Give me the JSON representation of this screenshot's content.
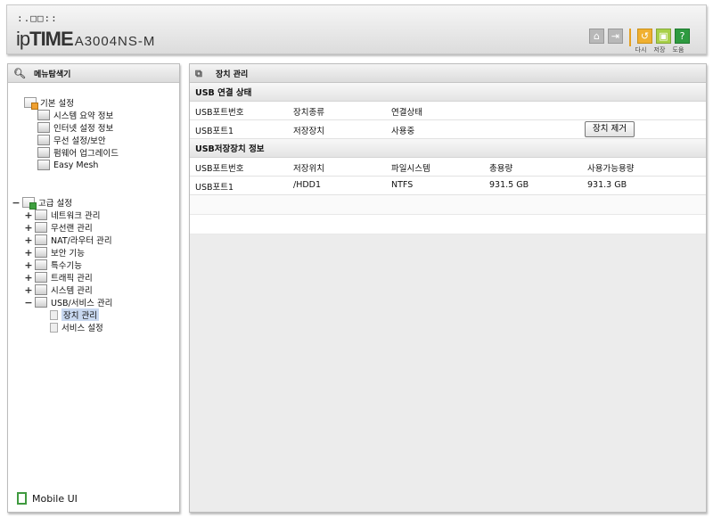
{
  "header": {
    "logo_squares": ":.□□::",
    "brand_ip": "ip",
    "brand_time": "TIME",
    "model": "A3004NS-M",
    "icons": [
      {
        "name": "home-icon",
        "color": "#b8b8b8"
      },
      {
        "name": "logout-icon",
        "color": "#b8b8b8"
      },
      {
        "name": "refresh-icon",
        "color": "#f0b030",
        "label": "다시"
      },
      {
        "name": "save-icon",
        "color": "#a8d048",
        "label": "저장"
      },
      {
        "name": "help-icon",
        "color": "#2e9a40",
        "label": "도움"
      }
    ]
  },
  "menu": {
    "title": "메뉴탐색기",
    "basic": {
      "label": "기본 설정",
      "items": [
        "시스템 요약 정보",
        "인터넷 설정 정보",
        "무선 설정/보안",
        "펌웨어 업그레이드",
        "Easy Mesh"
      ]
    },
    "advanced": {
      "label": "고급 설정",
      "items": [
        "네트워크 관리",
        "무선랜 관리",
        "NAT/라우터 관리",
        "보안 기능",
        "특수기능",
        "트래픽 관리",
        "시스템 관리",
        "USB/서비스 관리"
      ],
      "usb_children": [
        "장치 관리",
        "서비스 설정"
      ]
    },
    "mobile_label": "Mobile UI",
    "toggle_plus": "+",
    "toggle_minus": "−"
  },
  "main": {
    "title": "장치 관리",
    "usb_status": {
      "title": "USB 연결 상태",
      "columns": [
        "USB포트번호",
        "장치종류",
        "연결상태"
      ],
      "row": [
        "USB포트1",
        "저장장치",
        "사용중"
      ],
      "remove_button": "장치 제거"
    },
    "storage_info": {
      "title": "USB저장장치 정보",
      "columns": [
        "USB포트번호",
        "저장위치",
        "파일시스템",
        "총용량",
        "사용가능용량"
      ],
      "row": [
        "USB포트1",
        "/HDD1",
        "NTFS",
        "931.5 GB",
        "931.3 GB"
      ]
    }
  }
}
